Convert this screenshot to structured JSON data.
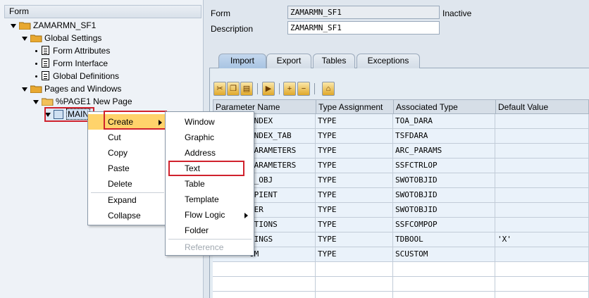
{
  "tree": {
    "header": "Form",
    "nodes": {
      "root": "ZAMARMN_SF1",
      "global_settings": "Global Settings",
      "form_attributes": "Form Attributes",
      "form_interface": "Form Interface",
      "global_definitions": "Global Definitions",
      "pages_and_windows": "Pages and Windows",
      "page1": "%PAGE1 New Page",
      "main": "MAIN"
    }
  },
  "form": {
    "form_label": "Form",
    "form_value": "ZAMARMN_SF1",
    "status": "Inactive",
    "description_label": "Description",
    "description_value": "ZAMARMN_SF1"
  },
  "tabs": [
    "Import",
    "Export",
    "Tables",
    "Exceptions"
  ],
  "grid": {
    "headers": [
      "Parameter Name",
      "Type Assignment",
      "Associated Type",
      "Default Value"
    ],
    "rows": [
      [
        "INDEX",
        "TYPE",
        "TOA_DARA",
        ""
      ],
      [
        "INDEX_TAB",
        "TYPE",
        "TSFDARA",
        ""
      ],
      [
        "PARAMETERS",
        "TYPE",
        "ARC_PARAMS",
        ""
      ],
      [
        "PARAMETERS",
        "TYPE",
        "SSFCTRLOP",
        ""
      ],
      [
        "L_OBJ",
        "TYPE",
        "SWOTOBJID",
        ""
      ],
      [
        "IPIENT",
        "TYPE",
        "SWOTOBJID",
        ""
      ],
      [
        "DER",
        "TYPE",
        "SWOTOBJID",
        ""
      ],
      [
        "PTIONS",
        "TYPE",
        "SSFCOMPOP",
        ""
      ],
      [
        "TINGS",
        "TYPE",
        "TDBOOL",
        "'X'"
      ],
      [
        "OM",
        "TYPE",
        "SCUSTOM",
        ""
      ]
    ]
  },
  "context_menu": {
    "create": "Create",
    "cut": "Cut",
    "copy": "Copy",
    "paste": "Paste",
    "delete": "Delete",
    "expand": "Expand",
    "collapse": "Collapse"
  },
  "create_submenu": {
    "window": "Window",
    "graphic": "Graphic",
    "address": "Address",
    "text": "Text",
    "table": "Table",
    "template": "Template",
    "flow_logic": "Flow Logic",
    "folder": "Folder",
    "reference": "Reference"
  },
  "colors": {
    "highlight": "#ffd36b",
    "annotation": "#d0222d",
    "folder": "#e8a830"
  }
}
